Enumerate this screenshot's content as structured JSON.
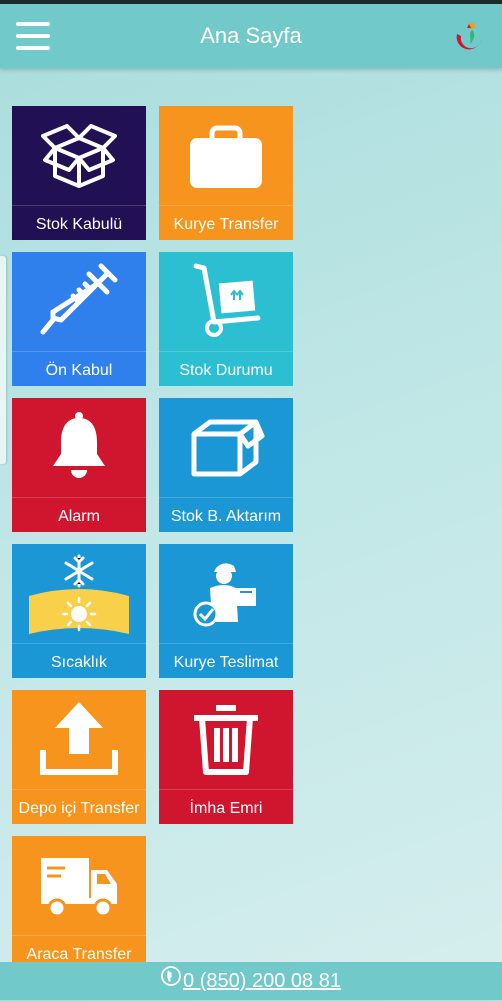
{
  "header": {
    "title": "Ana Sayfa",
    "menu_icon": "hamburger-menu-icon",
    "logo_icon": "ministry-logo-icon"
  },
  "tiles": [
    {
      "label": "Stok Kabulü",
      "icon": "open-box-icon",
      "color": "#211154"
    },
    {
      "label": "Kurye Transfer",
      "icon": "briefcase-icon",
      "color": "#f7941d"
    },
    {
      "label": "Ön Kabul",
      "icon": "syringe-icon",
      "color": "#2f80ec"
    },
    {
      "label": "Stok Durumu",
      "icon": "hand-truck-icon",
      "color": "#2cbfd2"
    },
    {
      "label": "Alarm",
      "icon": "bell-icon",
      "color": "#d0152f"
    },
    {
      "label": "Stok B. Aktarım",
      "icon": "box-transfer-icon",
      "color": "#1b97d6"
    },
    {
      "label": "Sıcaklık",
      "icon": "temperature-snow-sun-icon",
      "color": "#1b97d6"
    },
    {
      "label": "Kurye Teslimat",
      "icon": "courier-delivery-icon",
      "color": "#1b97d6"
    },
    {
      "label": "Depo içi Transfer",
      "icon": "upload-tray-icon",
      "color": "#f7941d"
    },
    {
      "label": "İmha Emri",
      "icon": "trash-icon",
      "color": "#d0152f"
    },
    {
      "label": "Araca Transfer",
      "icon": "truck-icon",
      "color": "#f7941d"
    }
  ],
  "footer": {
    "phone": "0 (850) 200 08 81",
    "phone_icon": "phone-icon"
  }
}
